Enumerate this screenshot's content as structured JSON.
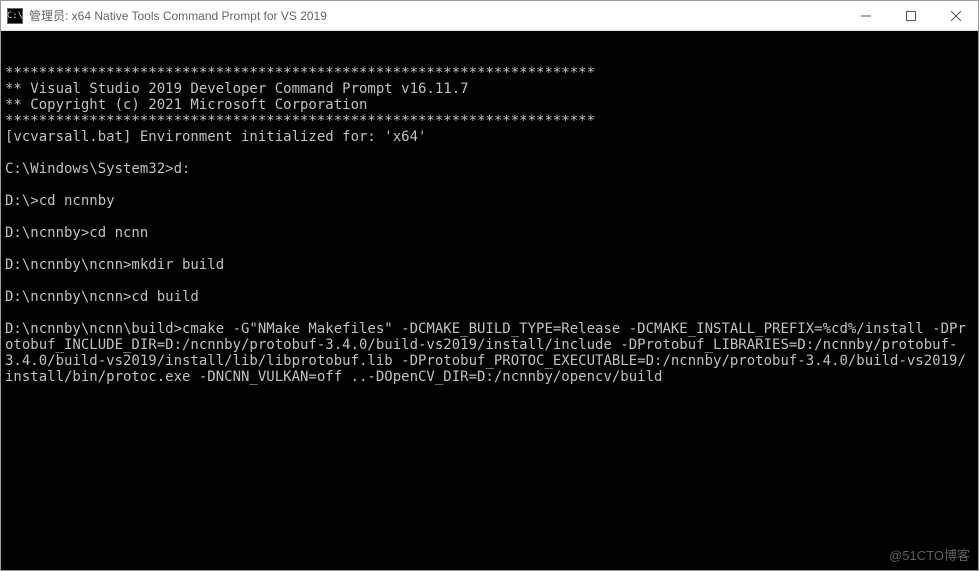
{
  "window": {
    "title": "管理员: x64 Native Tools Command Prompt for VS 2019",
    "icon_label": "C:\\"
  },
  "terminal": {
    "lines": [
      "**********************************************************************",
      "** Visual Studio 2019 Developer Command Prompt v16.11.7",
      "** Copyright (c) 2021 Microsoft Corporation",
      "**********************************************************************",
      "[vcvarsall.bat] Environment initialized for: 'x64'",
      "",
      "C:\\Windows\\System32>d:",
      "",
      "D:\\>cd ncnnby",
      "",
      "D:\\ncnnby>cd ncnn",
      "",
      "D:\\ncnnby\\ncnn>mkdir build",
      "",
      "D:\\ncnnby\\ncnn>cd build",
      "",
      "D:\\ncnnby\\ncnn\\build>cmake -G\"NMake Makefiles\" -DCMAKE_BUILD_TYPE=Release -DCMAKE_INSTALL_PREFIX=%cd%/install -DProtobuf_INCLUDE_DIR=D:/ncnnby/protobuf-3.4.0/build-vs2019/install/include -DProtobuf_LIBRARIES=D:/ncnnby/protobuf-3.4.0/build-vs2019/install/lib/libprotobuf.lib -DProtobuf_PROTOC_EXECUTABLE=D:/ncnnby/protobuf-3.4.0/build-vs2019/install/bin/protoc.exe -DNCNN_VULKAN=off ..-DOpenCV_DIR=D:/ncnnby/opencv/build"
    ]
  },
  "watermark": "@51CTO博客"
}
